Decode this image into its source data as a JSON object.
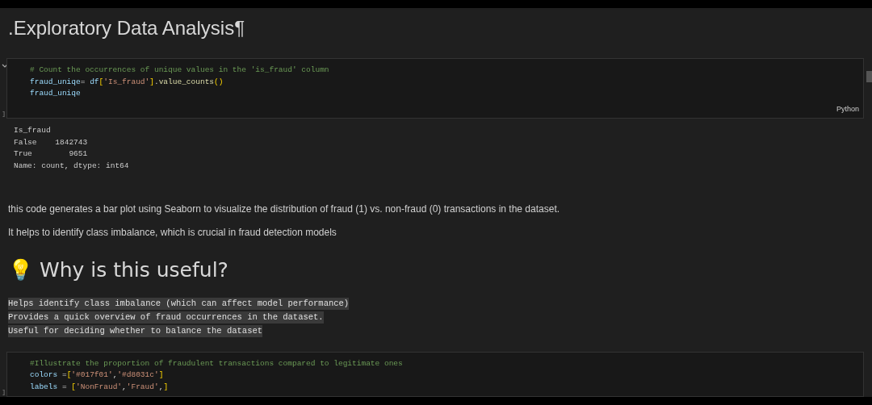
{
  "title": ".Exploratory Data Analysis¶",
  "cells": [
    {
      "kind": "code",
      "exec_count": "]",
      "language": "Python",
      "lines": [
        [
          {
            "kind": "comment",
            "text": "# Count the occurrences of unique values in the 'is_fraud' column"
          }
        ],
        [
          {
            "kind": "variable",
            "text": "fraud_uniqe"
          },
          {
            "kind": "plain",
            "text": "= "
          },
          {
            "kind": "variable",
            "text": "df"
          },
          {
            "kind": "bracket",
            "text": "["
          },
          {
            "kind": "string",
            "text": "'Is_fraud'"
          },
          {
            "kind": "bracket",
            "text": "]"
          },
          {
            "kind": "plain",
            "text": "."
          },
          {
            "kind": "function",
            "text": "value_counts"
          },
          {
            "kind": "bracket",
            "text": "()"
          }
        ],
        [
          {
            "kind": "variable",
            "text": "fraud_uniqe"
          }
        ]
      ],
      "output": [
        "Is_fraud",
        "False    1842743",
        "True        9651",
        "Name: count, dtype: int64"
      ]
    },
    {
      "kind": "markdown",
      "paragraphs": [
        "this code generates a bar plot using Seaborn to visualize the distribution of fraud (1) vs. non-fraud (0) transactions in the dataset.",
        "It helps to identify class imbalance, which is crucial in fraud detection models"
      ],
      "heading": "💡 Why is this useful?",
      "code_lines": [
        "Helps identify class imbalance (which can affect model performance)",
        "Provides a quick overview of fraud occurrences in the dataset.",
        "Useful for deciding whether to balance the dataset"
      ]
    },
    {
      "kind": "code",
      "exec_count": "]",
      "lines": [
        [
          {
            "kind": "comment",
            "text": "#Illustrate the proportion of fraudulent transactions compared to legitimate ones"
          }
        ],
        [
          {
            "kind": "variable",
            "text": "colors"
          },
          {
            "kind": "plain",
            "text": " ="
          },
          {
            "kind": "bracket",
            "text": "["
          },
          {
            "kind": "string",
            "text": "'#017f01'"
          },
          {
            "kind": "plain",
            "text": ","
          },
          {
            "kind": "string",
            "text": "'#d8031c'"
          },
          {
            "kind": "bracket",
            "text": "]"
          }
        ],
        [
          {
            "kind": "variable",
            "text": "labels"
          },
          {
            "kind": "plain",
            "text": " = "
          },
          {
            "kind": "bracket",
            "text": "["
          },
          {
            "kind": "string",
            "text": "'NonFraud'"
          },
          {
            "kind": "plain",
            "text": ","
          },
          {
            "kind": "string",
            "text": "'Fraud'"
          },
          {
            "kind": "plain",
            "text": ","
          },
          {
            "kind": "bracket",
            "text": "]"
          }
        ]
      ]
    }
  ]
}
